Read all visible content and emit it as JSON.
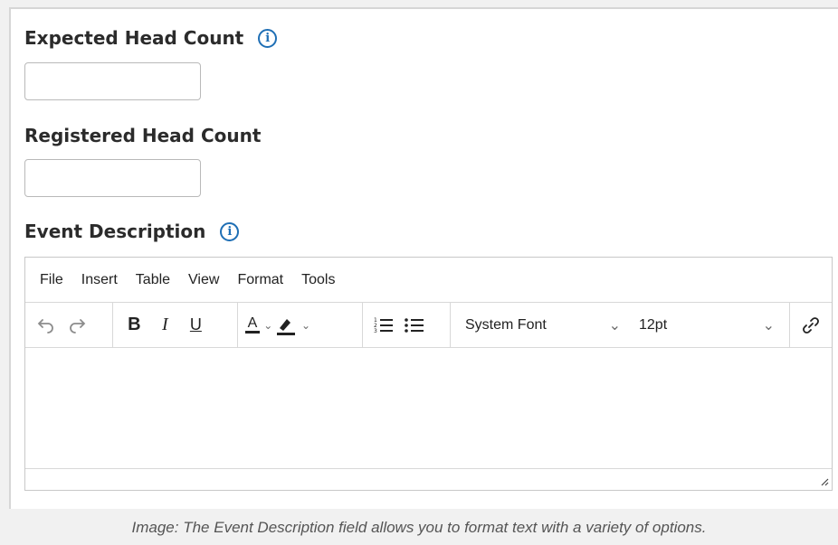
{
  "fields": {
    "expected_head_count": {
      "label": "Expected Head Count",
      "value": ""
    },
    "registered_head_count": {
      "label": "Registered Head Count",
      "value": ""
    },
    "event_description": {
      "label": "Event Description"
    }
  },
  "editor": {
    "menu": [
      "File",
      "Insert",
      "Table",
      "View",
      "Format",
      "Tools"
    ],
    "toolbar": {
      "bold": "B",
      "italic": "I",
      "underline": "U",
      "text_color": "A",
      "font_family": "System Font",
      "font_size": "12pt"
    },
    "icons": [
      "undo-icon",
      "redo-icon",
      "text-color-icon",
      "highlight-icon",
      "numbered-list-icon",
      "bullet-list-icon",
      "chevron-down-icon",
      "link-icon",
      "resize-handle-icon",
      "info-icon"
    ]
  },
  "caption": "Image: The Event Description field allows you to format text with a variety of options.",
  "colors": {
    "info_blue": "#1f6fb5",
    "panel_bg": "#f1f1f1",
    "border": "#c8c8c8"
  }
}
